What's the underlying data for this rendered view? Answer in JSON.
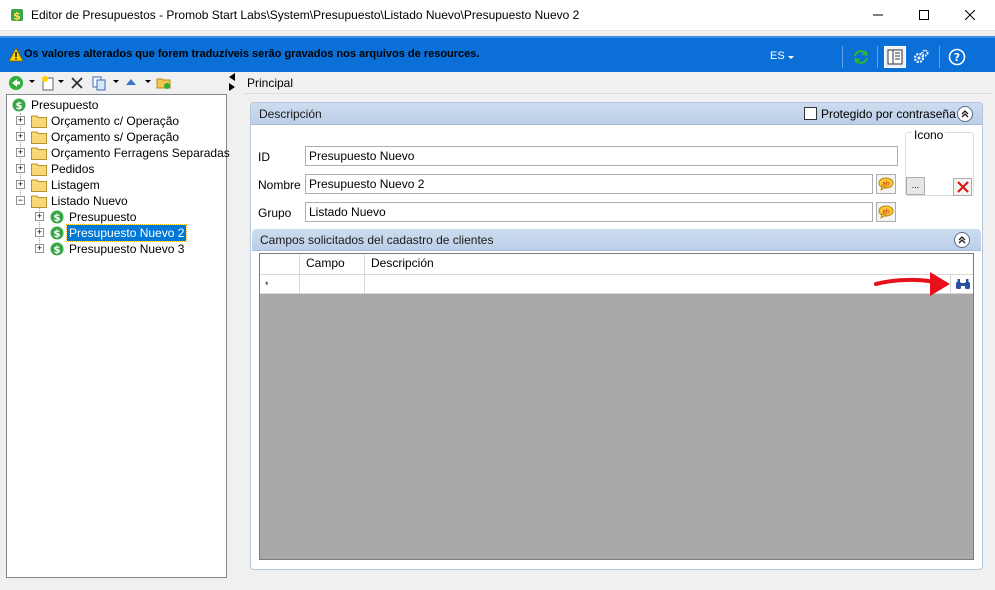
{
  "window": {
    "title": "Editor de Presupuestos - Promob Start Labs\\System\\Presupuesto\\Listado Nuevo\\Presupuesto Nuevo 2"
  },
  "infobar": {
    "message": "Os valores alterados que forem traduzíveis serão gravados nos arquivos de resources.",
    "language": "ES"
  },
  "tree": {
    "root": "Presupuesto",
    "items": [
      {
        "label": "Orçamento c/ Operação"
      },
      {
        "label": "Orçamento s/ Operação"
      },
      {
        "label": "Orçamento Ferragens Separadas"
      },
      {
        "label": "Pedidos"
      },
      {
        "label": "Listagem"
      },
      {
        "label": "Listado Nuevo"
      }
    ],
    "children": [
      {
        "label": "Presupuesto"
      },
      {
        "label": "Presupuesto Nuevo 2"
      },
      {
        "label": "Presupuesto Nuevo 3"
      }
    ]
  },
  "tab": {
    "label": "Principal"
  },
  "descripcion": {
    "header": "Descripción",
    "protect_label": "Protegido por contraseña",
    "icon_group": "Icono",
    "icon_browse": "...",
    "fields": {
      "id_label": "ID",
      "id_value": "Presupuesto Nuevo",
      "nombre_label": "Nombre",
      "nombre_value": "Presupuesto Nuevo 2",
      "grupo_label": "Grupo",
      "grupo_value": "Listado Nuevo"
    }
  },
  "campos": {
    "header": "Campos solicitados del cadastro de clientes",
    "columns": [
      "Campo",
      "Descripción"
    ],
    "new_row_marker": "*"
  },
  "colors": {
    "accent": "#0a6fd6",
    "selection": "#0078d7",
    "section_header": "#c4d6ec",
    "grid_empty": "#a9a9a9",
    "annotation_arrow": "#e8101a"
  }
}
